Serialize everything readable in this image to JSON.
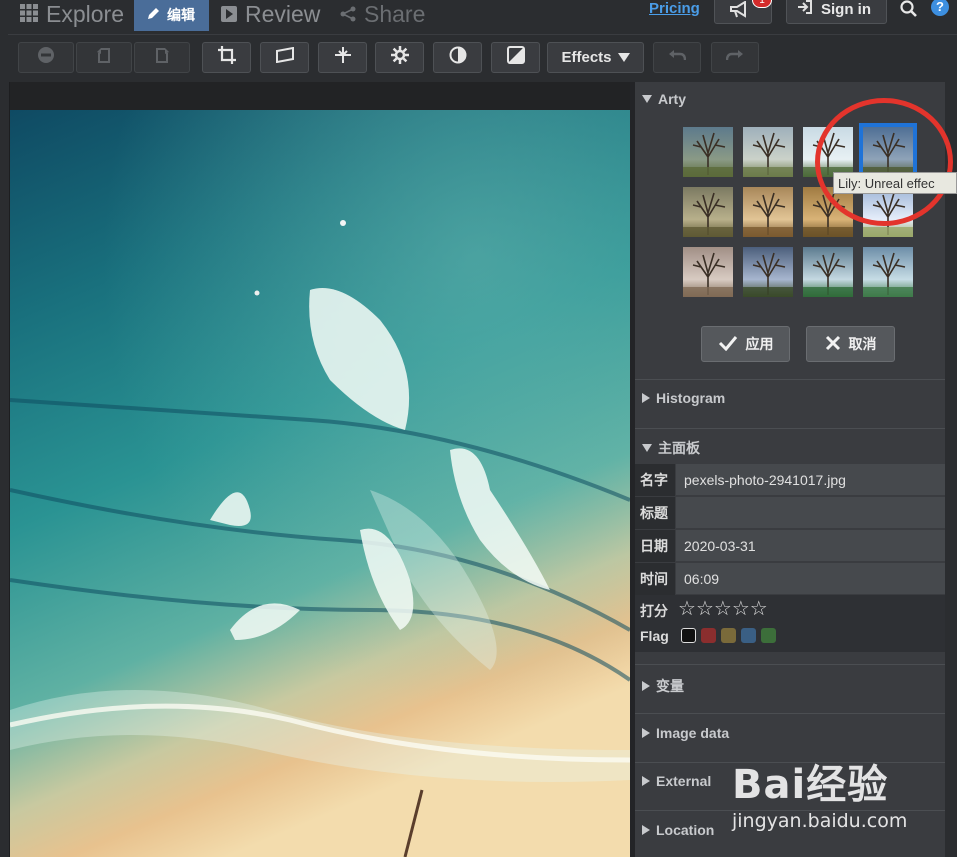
{
  "nav": {
    "explore_label": "Explore",
    "edit_label": "编辑",
    "review_label": "Review",
    "share_label": "Share",
    "pricing_label": "Pricing",
    "sign_in_label": "Sign in"
  },
  "toolbar": {
    "effects_label": "Effects"
  },
  "panel": {
    "arty_title": "Arty",
    "tooltip": "Lily: Unreal effec",
    "apply_label": "应用",
    "cancel_label": "取消",
    "histogram_title": "Histogram",
    "main_panel_title": "主面板",
    "variables_title": "变量",
    "image_data_title": "Image data",
    "external_title": "External",
    "location_title": "Location"
  },
  "metadata": {
    "name_label": "名字",
    "name_value": "pexels-photo-2941017.jpg",
    "title_label": "标题",
    "title_value": "",
    "date_label": "日期",
    "date_value": "2020-03-31",
    "time_label": "时间",
    "time_value": "06:09",
    "rating_label": "打分",
    "rating_value": 0,
    "rating_max": 5,
    "flag_label": "Flag",
    "flag_colors": [
      "#111111",
      "#8b2e2e",
      "#7a6a3a",
      "#3a5f84",
      "#3c6e3a"
    ]
  },
  "watermark": {
    "brand": "Bai经验",
    "url": "jingyan.baidu.com"
  },
  "colors": {
    "accent_blue": "#1f73d8",
    "highlight_ring": "#e3342c",
    "edit_tab_bg": "#4a6d99"
  }
}
